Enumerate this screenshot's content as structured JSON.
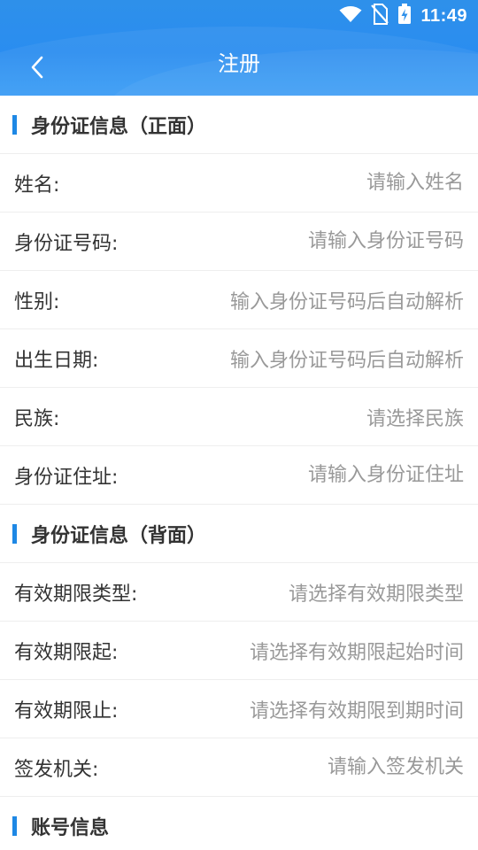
{
  "status_bar": {
    "time": "11:49",
    "icons": [
      "wifi-icon",
      "no-sim-icon",
      "battery-charging-icon"
    ]
  },
  "nav": {
    "title": "注册",
    "back_icon": "chevron-left-icon"
  },
  "front_section": {
    "title": "身份证信息（正面）",
    "rows": [
      {
        "label": "姓名:",
        "placeholder": "请输入姓名"
      },
      {
        "label": "身份证号码:",
        "placeholder": "请输入身份证号码"
      },
      {
        "label": "性别:",
        "placeholder": "输入身份证号码后自动解析"
      },
      {
        "label": "出生日期:",
        "placeholder": "输入身份证号码后自动解析"
      },
      {
        "label": "民族:",
        "placeholder": "请选择民族"
      },
      {
        "label": "身份证住址:",
        "placeholder": "请输入身份证住址"
      }
    ]
  },
  "back_section": {
    "title": "身份证信息（背面）",
    "rows": [
      {
        "label": "有效期限类型:",
        "placeholder": "请选择有效期限类型"
      },
      {
        "label": "有效期限起:",
        "placeholder": "请选择有效期限起始时间"
      },
      {
        "label": "有效期限止:",
        "placeholder": "请选择有效期限到期时间"
      },
      {
        "label": "签发机关:",
        "placeholder": "请输入签发机关"
      }
    ]
  },
  "account_section": {
    "title": "账号信息"
  },
  "colors": {
    "header_blue": "#2a8df0",
    "accent_bar": "#1e88e5",
    "label_text": "#333333",
    "placeholder_text": "#999999",
    "divider": "#eeeeee"
  }
}
